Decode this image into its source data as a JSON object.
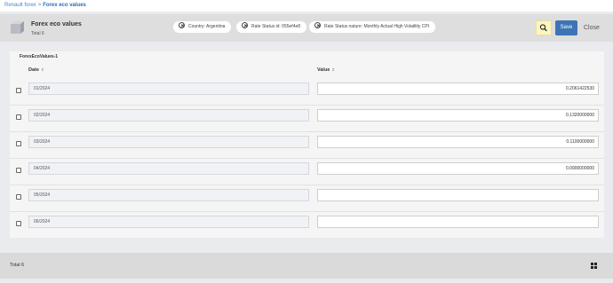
{
  "breadcrumb": {
    "parent": "Renault forex",
    "separator": ">",
    "current": "Forex eco values"
  },
  "header": {
    "title": "Forex eco values",
    "subtitle": "Total 6"
  },
  "filters": [
    {
      "label": "Country: Argentina"
    },
    {
      "label": "Rate Status id: 055ef4e8"
    },
    {
      "label": "Rate Status nature: Monthly Actual High Volatility CPI"
    }
  ],
  "actions": {
    "save": "Save",
    "close": "Close"
  },
  "section": {
    "title": "ForexEcoValues-1"
  },
  "columns": {
    "date": "Date",
    "value": "Value",
    "sort_glyph": "⇕"
  },
  "rows": [
    {
      "date": "01/2024",
      "value": "0.2061422530"
    },
    {
      "date": "02/2024",
      "value": "0.1320000000"
    },
    {
      "date": "03/2024",
      "value": "0.1100000000"
    },
    {
      "date": "04/2024",
      "value": "0.0900000000"
    },
    {
      "date": "05/2024",
      "value": ""
    },
    {
      "date": "06/2024",
      "value": ""
    }
  ],
  "footer": {
    "total": "Total 6"
  },
  "icons": {
    "object": "object-icon",
    "search": "search-icon",
    "remove": "close-circle-icon",
    "grid": "grid-icon"
  },
  "colors": {
    "accent": "#3d74b5",
    "link": "#4a86c5",
    "search_bg": "#fcf5c2"
  }
}
